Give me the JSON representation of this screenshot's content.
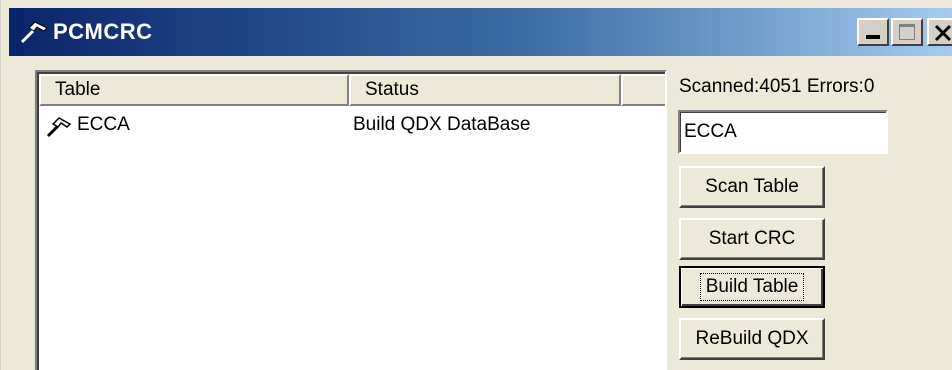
{
  "window": {
    "title": "PCMCRC",
    "icon": "hammer-icon"
  },
  "list": {
    "columns": [
      "Table",
      "Status",
      ""
    ],
    "rows": [
      {
        "table": "ECCA",
        "status": "Build QDX DataBase",
        "icon": "hammer-icon"
      }
    ]
  },
  "panel": {
    "counts": "Scanned:4051 Errors:0",
    "table_input_value": "ECCA",
    "buttons": {
      "scan": "Scan Table",
      "crc": "Start CRC",
      "build": "Build Table",
      "rebuild": "ReBuild QDX"
    }
  },
  "colors": {
    "titlebar_start": "#0a246a",
    "titlebar_end": "#a6caf0",
    "face": "#ece9d8"
  }
}
